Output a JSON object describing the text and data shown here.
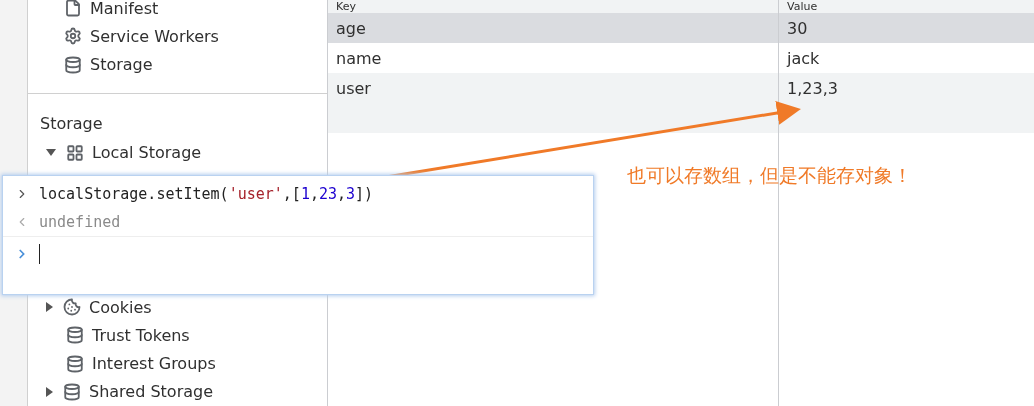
{
  "sidebar": {
    "app_items": [
      {
        "label": "Manifest",
        "kind": "file"
      },
      {
        "label": "Service Workers",
        "kind": "gear"
      },
      {
        "label": "Storage",
        "kind": "database"
      }
    ],
    "section_title": "Storage",
    "storage_items": [
      {
        "label": "Local Storage",
        "kind": "grid",
        "expanded": true
      },
      {
        "label": "Cookies",
        "kind": "cookie",
        "expanded": false
      },
      {
        "label": "Trust Tokens",
        "kind": "database"
      },
      {
        "label": "Interest Groups",
        "kind": "database"
      },
      {
        "label": "Shared Storage",
        "kind": "database",
        "expanded": false
      }
    ]
  },
  "table": {
    "columns": [
      "Key",
      "Value"
    ],
    "rows": [
      {
        "key": "age",
        "value": "30",
        "selected": true
      },
      {
        "key": "name",
        "value": "jack",
        "selected": false
      },
      {
        "key": "user",
        "value": "1,23,3",
        "selected": false
      }
    ]
  },
  "console": {
    "lines": [
      {
        "kind": "input",
        "tokens": [
          {
            "kind": "plain",
            "text": "localStorage.setItem("
          },
          {
            "kind": "string",
            "text": "'user'"
          },
          {
            "kind": "plain",
            "text": ",["
          },
          {
            "kind": "number",
            "text": "1"
          },
          {
            "kind": "plain",
            "text": ","
          },
          {
            "kind": "number",
            "text": "23"
          },
          {
            "kind": "plain",
            "text": ","
          },
          {
            "kind": "number",
            "text": "3"
          },
          {
            "kind": "plain",
            "text": "])"
          }
        ]
      },
      {
        "kind": "result",
        "tokens": [
          {
            "kind": "muted",
            "text": "undefined"
          }
        ]
      },
      {
        "kind": "prompt"
      }
    ]
  },
  "annotation": {
    "text": "也可以存数组，但是不能存对象！"
  }
}
